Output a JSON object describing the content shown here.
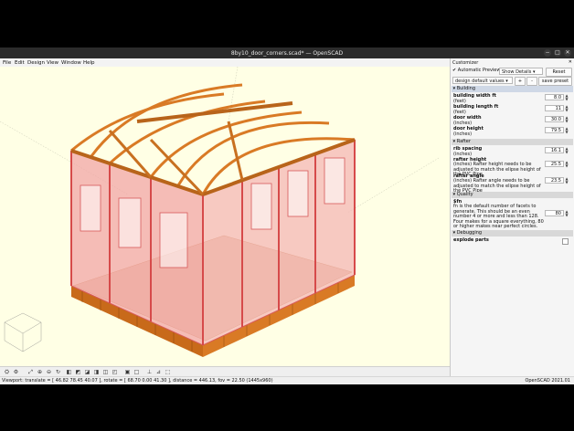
{
  "window": {
    "title": "8by10_door_corners.scad* — OpenSCAD",
    "buttons": [
      "−",
      "□",
      "✕"
    ]
  },
  "menu": [
    "File",
    "Edit",
    "Design",
    "View",
    "Window",
    "Help"
  ],
  "customizer": {
    "title": "Customizer",
    "auto_preview": "Automatic Preview",
    "auto_preview_checked": true,
    "show_details": "Show Details",
    "reset": "Reset",
    "preset": "design default values",
    "plus": "+",
    "minus": "-",
    "save_preset": "save preset",
    "sections": [
      {
        "name": "Building",
        "params": [
          {
            "label": "building width ft",
            "desc": "(feet)",
            "value": "8.0"
          },
          {
            "label": "building length ft",
            "desc": "(feet)",
            "value": "11"
          },
          {
            "label": "door width",
            "desc": "(inches)",
            "value": "30.0"
          },
          {
            "label": "door height",
            "desc": "(inches)",
            "value": "79.5"
          }
        ]
      },
      {
        "name": "Rafter",
        "params": [
          {
            "label": "rib spacing",
            "desc": "(inches)",
            "value": "16.1"
          },
          {
            "label": "rafter height",
            "desc": "(inches) Rafter height needs to be adjusted to match the elipse height of the PVC Pipe",
            "value": "25.5"
          },
          {
            "label": "rafter angle",
            "desc": "(inches) Rafter angle needs to be adjusted to match the elipse height of the PVC Pipe",
            "value": "23.5"
          }
        ]
      },
      {
        "name": "Quality",
        "params": [
          {
            "label": "$fn",
            "desc": "fn is the default number of facets to generate. This should be an even number 4 or more and less than 128. Four makes for a square everything, 80 or higher makes near perfect circles.",
            "value": "80"
          }
        ]
      },
      {
        "name": "Debugging",
        "params": [
          {
            "label": "explode parts",
            "desc": "",
            "value": ""
          }
        ]
      }
    ]
  },
  "status": {
    "viewport": "Viewport: translate = [ 46.82 78.45 40.07 ], rotate = [ 68.70 0.00 41.30 ], distance = 446.13, fov = 22.50 (1445x960)",
    "version": "OpenSCAD 2021.01"
  },
  "colors": {
    "viewport_bg": "#ffffe5",
    "timber": "#e08a2e",
    "glass": "#f0a8a8",
    "frame": "#e06060"
  },
  "toolbar_icons": [
    "preview-icon",
    "render-icon",
    "view-all-icon",
    "zoom-in-icon",
    "zoom-out-icon",
    "reset-view-icon",
    "right-view-icon",
    "top-view-icon",
    "bottom-view-icon",
    "left-view-icon",
    "front-view-icon",
    "back-view-icon",
    "perspective-icon",
    "orthogonal-icon",
    "show-axes-icon",
    "show-scale-icon",
    "show-edges-icon"
  ]
}
